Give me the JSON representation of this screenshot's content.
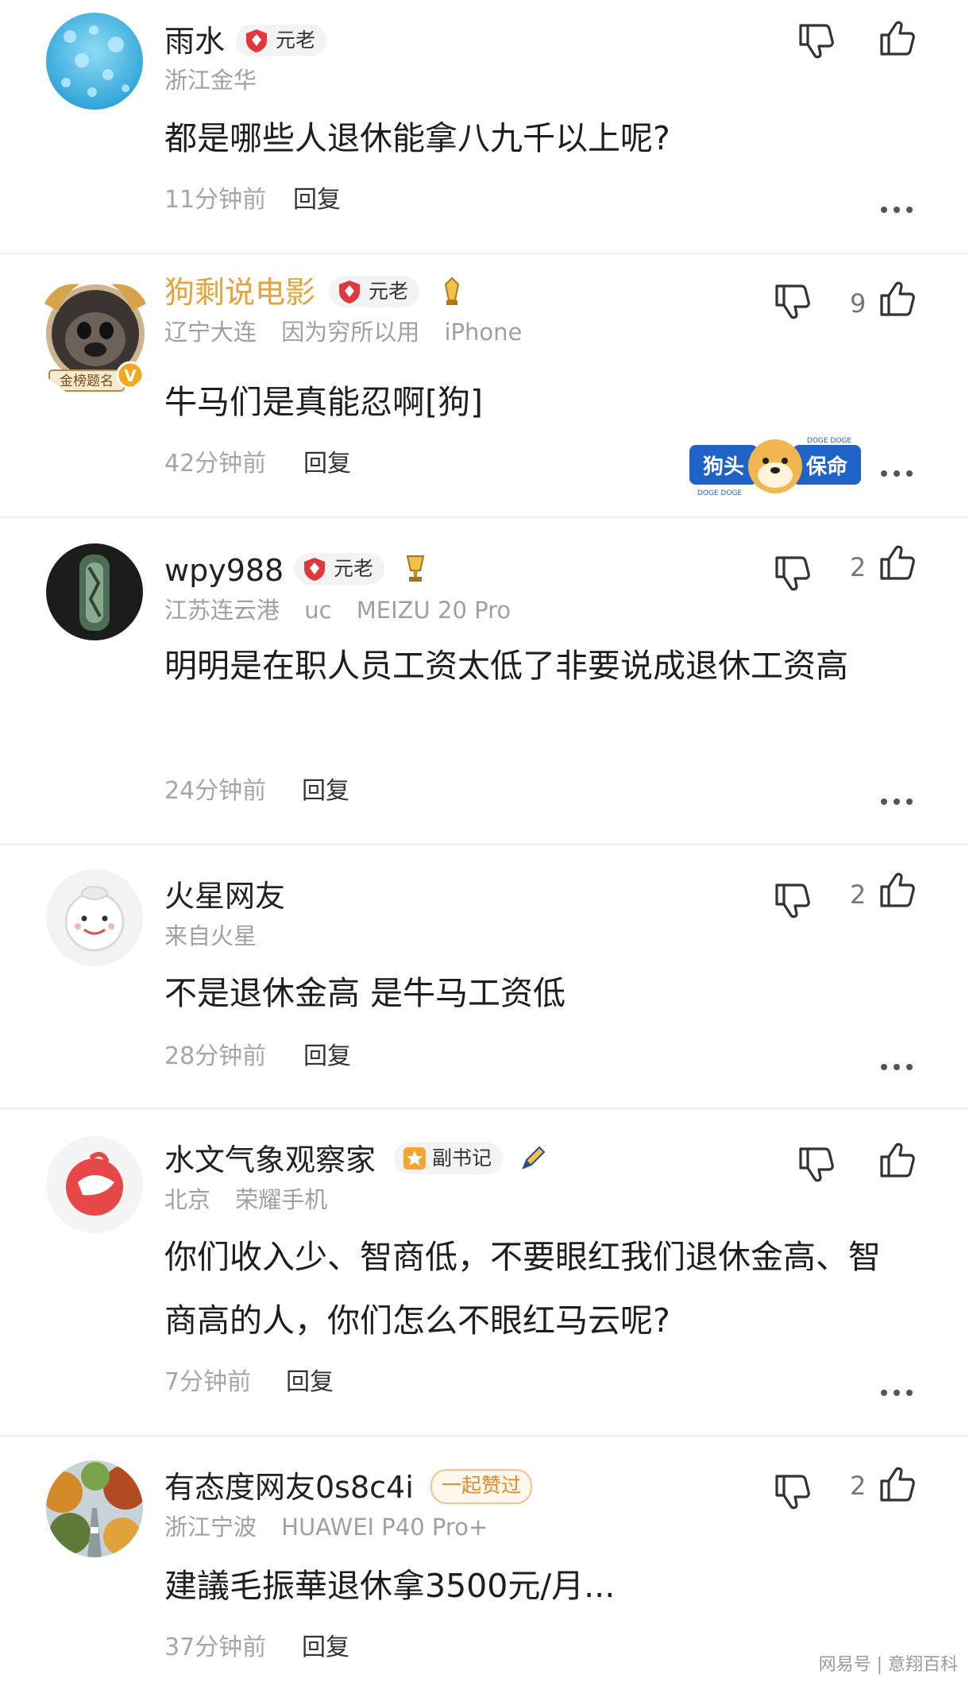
{
  "actions": {
    "reply_label": "回复"
  },
  "comments": [
    {
      "username": "雨水",
      "badge": "元老",
      "meta": [
        "浙江金华"
      ],
      "text": "都是哪些人退休能拿八九千以上呢?",
      "time": "11分钟前",
      "likes": ""
    },
    {
      "username": "狗剩说电影",
      "badge": "元老",
      "meta": [
        "辽宁大连",
        "因为穷所以用",
        "iPhone"
      ],
      "text": "牛马们是真能忍啊[狗]",
      "time": "42分钟前",
      "likes": "9",
      "avatar_frame_text": "金榜题名",
      "sticker": {
        "left": "狗头",
        "right": "保命",
        "small": "DOGE DOGE"
      }
    },
    {
      "username": "wpy988",
      "badge": "元老",
      "meta": [
        "江苏连云港",
        "uc",
        "MEIZU 20 Pro"
      ],
      "text": "明明是在职人员工资太低了非要说成退休工资高",
      "time": "24分钟前",
      "likes": "2"
    },
    {
      "username": "火星网友",
      "badge": "",
      "meta": [
        "来自火星"
      ],
      "text": "不是退休金高 是牛马工资低",
      "time": "28分钟前",
      "likes": "2"
    },
    {
      "username": "水文气象观察家",
      "badge": "副书记",
      "meta": [
        "北京",
        "荣耀手机"
      ],
      "text": "你们收入少、智商低，不要眼红我们退休金高、智商高的人，你们怎么不眼红马云呢?",
      "time": "7分钟前",
      "likes": ""
    },
    {
      "username": "有态度网友0s8c4i",
      "badge": "一起赞过",
      "meta": [
        "浙江宁波",
        "HUAWEI P40 Pro+"
      ],
      "text": "建議毛振華退休拿3500元/月...",
      "time": "37分钟前",
      "likes": "2"
    }
  ],
  "watermark": "网易号 | 意翔百科",
  "colors": {
    "gold_username": "#e8a23b",
    "badge_red": "#e0383e",
    "meta_gray": "#a0a0a0"
  }
}
